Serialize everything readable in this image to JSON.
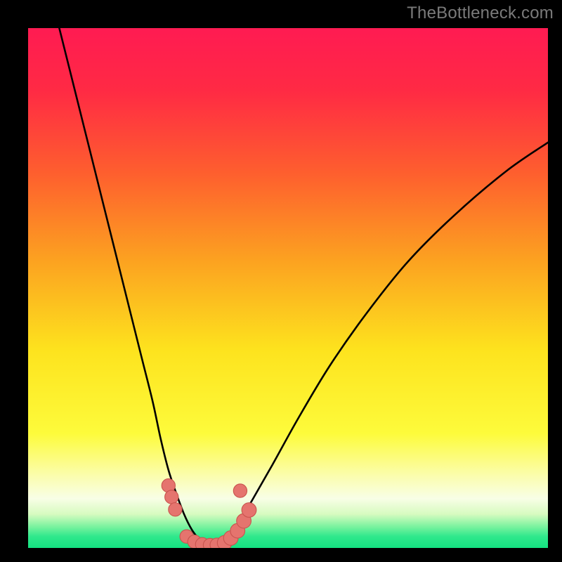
{
  "attribution": "TheBottleneck.com",
  "colors": {
    "background": "#000000",
    "curve": "#000000",
    "marker_fill": "#e5746e",
    "marker_stroke": "#c9544e",
    "gradient_stops": [
      {
        "offset": 0.0,
        "color": "#ff1b52"
      },
      {
        "offset": 0.12,
        "color": "#ff2a44"
      },
      {
        "offset": 0.28,
        "color": "#fe5f2e"
      },
      {
        "offset": 0.45,
        "color": "#fca320"
      },
      {
        "offset": 0.62,
        "color": "#fde31e"
      },
      {
        "offset": 0.78,
        "color": "#fdfb3b"
      },
      {
        "offset": 0.86,
        "color": "#fbfdac"
      },
      {
        "offset": 0.905,
        "color": "#f8fee6"
      },
      {
        "offset": 0.935,
        "color": "#d7fbc0"
      },
      {
        "offset": 0.958,
        "color": "#7ef3a0"
      },
      {
        "offset": 0.978,
        "color": "#2fe88c"
      },
      {
        "offset": 1.0,
        "color": "#14e281"
      }
    ]
  },
  "chart_data": {
    "type": "line",
    "title": "",
    "xlabel": "",
    "ylabel": "",
    "xlim": [
      0,
      100
    ],
    "ylim": [
      0,
      100
    ],
    "series": [
      {
        "name": "left-curve",
        "x": [
          6,
          8,
          10,
          12,
          14,
          16,
          18,
          20,
          22,
          24,
          25.5,
          27,
          28.5,
          30,
          31.5,
          33
        ],
        "y": [
          100,
          92,
          84,
          76,
          68,
          60,
          52,
          44,
          36,
          28,
          21,
          15,
          10.5,
          6.5,
          3.5,
          1.5
        ]
      },
      {
        "name": "right-curve",
        "x": [
          38,
          40,
          43,
          47,
          52,
          58,
          65,
          73,
          82,
          92,
          100
        ],
        "y": [
          1.5,
          4,
          9,
          16,
          25,
          35,
          45,
          55,
          64,
          72.5,
          78
        ]
      },
      {
        "name": "valley-floor",
        "x": [
          33,
          34,
          35,
          36,
          37,
          38
        ],
        "y": [
          1.5,
          0.8,
          0.5,
          0.5,
          0.8,
          1.5
        ]
      }
    ],
    "markers": [
      {
        "x": 27.0,
        "y": 12.0,
        "r": 1.3
      },
      {
        "x": 27.6,
        "y": 9.8,
        "r": 1.3
      },
      {
        "x": 28.3,
        "y": 7.4,
        "r": 1.3
      },
      {
        "x": 30.5,
        "y": 2.2,
        "r": 1.3
      },
      {
        "x": 32.0,
        "y": 1.2,
        "r": 1.3
      },
      {
        "x": 33.5,
        "y": 0.7,
        "r": 1.3
      },
      {
        "x": 35.0,
        "y": 0.55,
        "r": 1.3
      },
      {
        "x": 36.3,
        "y": 0.6,
        "r": 1.3
      },
      {
        "x": 37.8,
        "y": 1.0,
        "r": 1.4
      },
      {
        "x": 39.0,
        "y": 1.9,
        "r": 1.4
      },
      {
        "x": 40.3,
        "y": 3.3,
        "r": 1.4
      },
      {
        "x": 41.5,
        "y": 5.2,
        "r": 1.4
      },
      {
        "x": 42.5,
        "y": 7.3,
        "r": 1.4
      },
      {
        "x": 40.8,
        "y": 11.0,
        "r": 1.3
      }
    ]
  }
}
